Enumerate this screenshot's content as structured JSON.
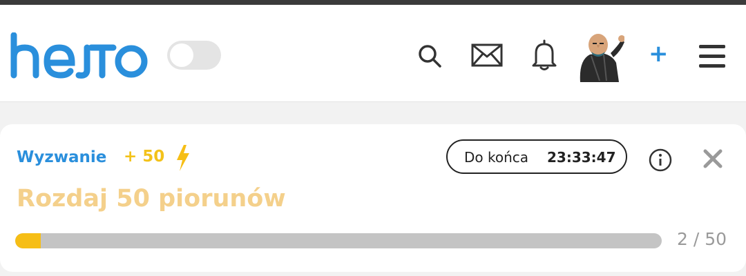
{
  "header": {
    "logo_text": "hejto",
    "toggle_state": "off",
    "icons": [
      "search-icon",
      "mail-icon",
      "bell-icon",
      "avatar",
      "plus-icon",
      "menu-icon"
    ],
    "plus_label": "+",
    "accent_color": "#2a8fdc"
  },
  "challenge": {
    "label": "Wyzwanie",
    "reward": "+ 50",
    "reward_icon": "lightning-icon",
    "timer_label": "Do końca",
    "timer_value": "23:33:47",
    "title": "Rozdaj 50 piorunów",
    "progress": {
      "current": 2,
      "total": 50,
      "fraction": 0.04,
      "text": "2 / 50",
      "fill_color": "#f6be16"
    },
    "title_color": "#f4d08b"
  }
}
